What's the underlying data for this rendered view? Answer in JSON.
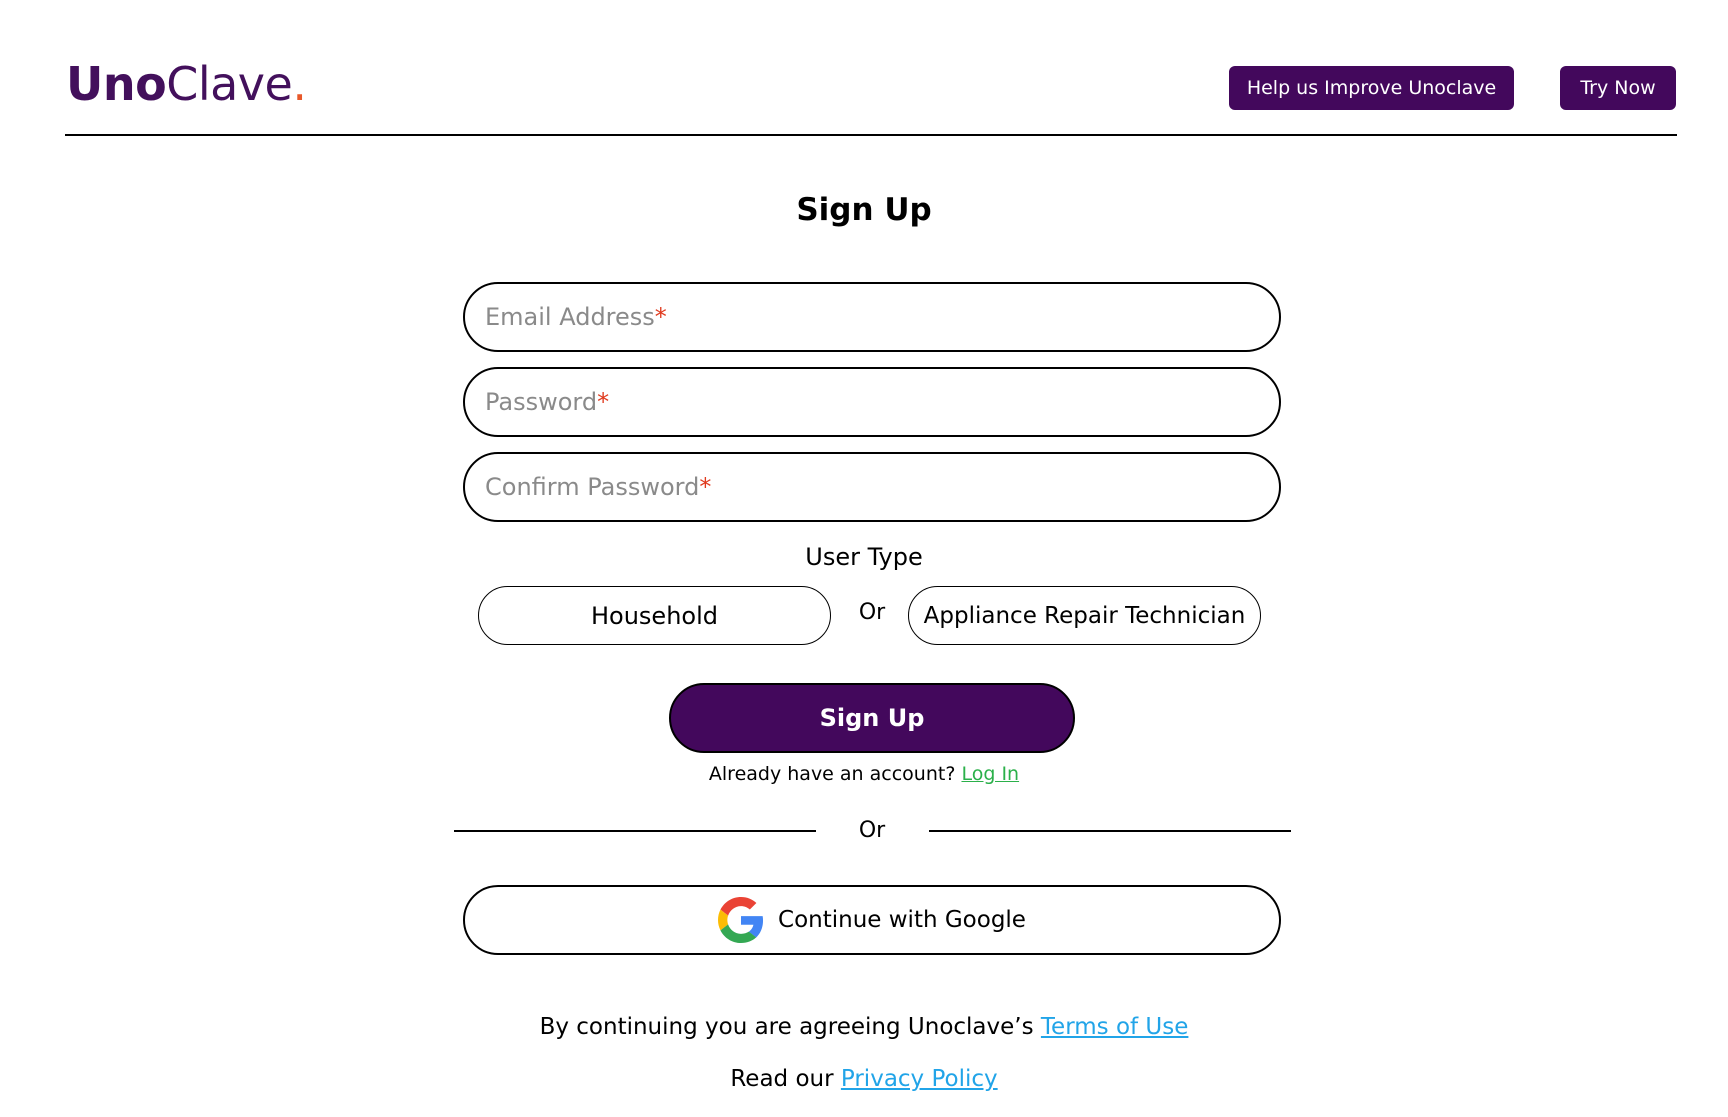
{
  "header": {
    "logo_part1": "Uno",
    "logo_part2": "Clave",
    "logo_dot": ".",
    "help_button": "Help us Improve Unoclave",
    "try_button": "Try Now"
  },
  "form": {
    "title": "Sign Up",
    "email_placeholder": "Email Address",
    "password_placeholder": "Password",
    "confirm_placeholder": "Confirm Password",
    "required_mark": "*",
    "user_type_label": "User Type",
    "user_types": [
      "Household",
      "Appliance Repair Technician"
    ],
    "or_text": "Or",
    "submit_label": "Sign Up",
    "already_text": "Already have an account?",
    "login_link": "Log In",
    "divider_text": "Or",
    "google_label": "Continue with Google"
  },
  "legal": {
    "terms_prefix": "By continuing you are agreeing Unoclave’s",
    "terms_link": "Terms of Use",
    "privacy_prefix": "Read our",
    "privacy_link": "Privacy Policy"
  },
  "colors": {
    "brand_purple": "#43085c",
    "accent_orange": "#e8582a",
    "required_red": "#e03a1e",
    "login_green": "#2bb04a",
    "link_blue": "#21a4e8"
  },
  "icons": {
    "google": "google-icon"
  }
}
